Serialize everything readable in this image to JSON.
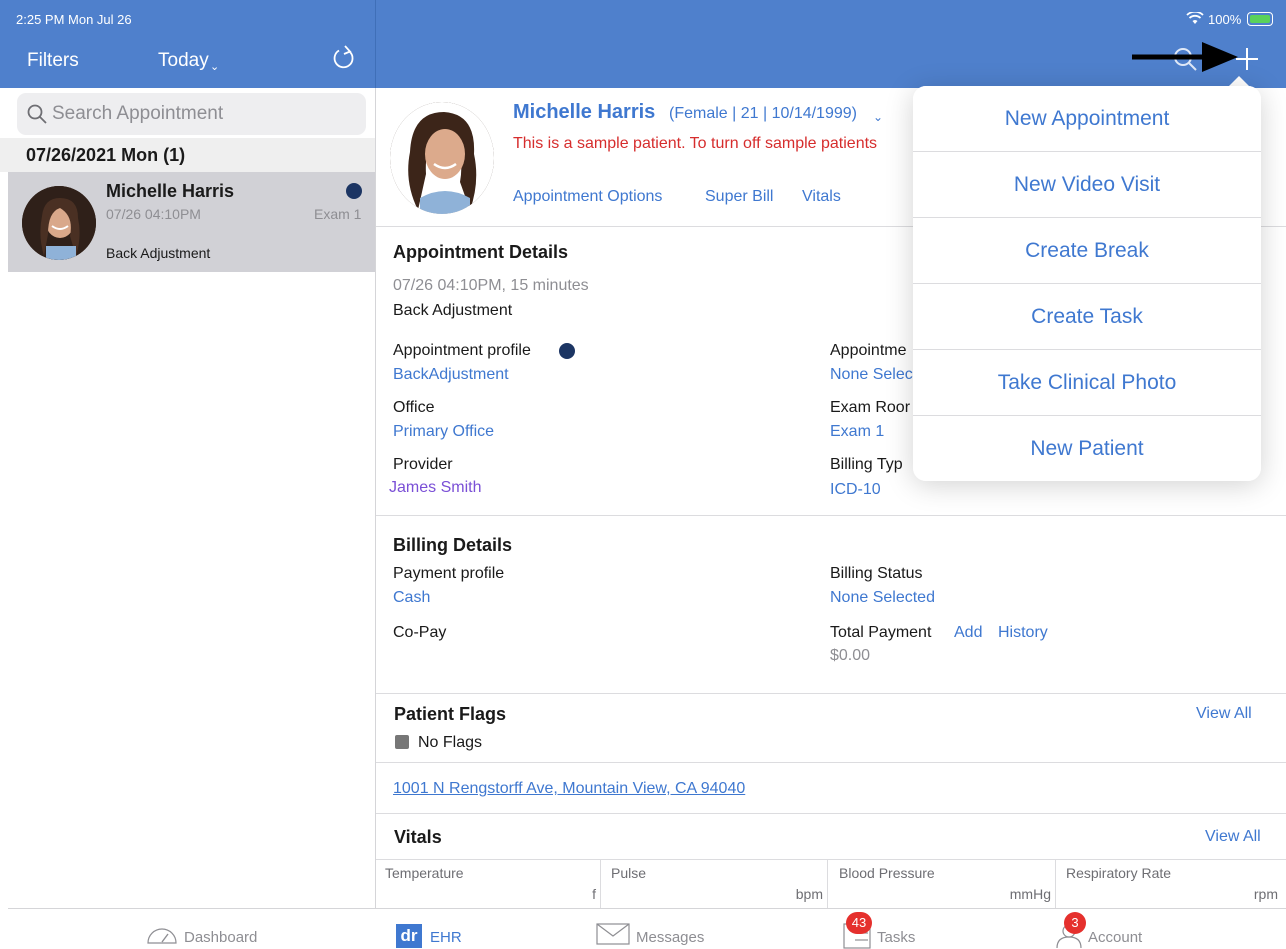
{
  "status_bar": {
    "time": "2:25 PM  Mon Jul 26",
    "battery": "100%"
  },
  "header": {
    "filters_label": "Filters",
    "today_label": "Today"
  },
  "sidebar": {
    "search_placeholder": "Search Appointment",
    "date_group": "07/26/2021 Mon (1)",
    "appointment": {
      "name": "Michelle Harris",
      "time": "07/26 04:10PM",
      "room": "Exam 1",
      "reason": "Back Adjustment"
    }
  },
  "patient": {
    "name": "Michelle Harris",
    "meta": "(Female | 21 | 10/14/1999)",
    "sample_notice": "This is a sample patient. To turn off sample patients",
    "links": {
      "appointment_options": "Appointment Options",
      "super_bill": "Super Bill",
      "vitals": "Vitals"
    }
  },
  "appointment_details": {
    "title": "Appointment Details",
    "datetime": "07/26 04:10PM, 15 minutes",
    "reason": "Back Adjustment",
    "profile_label": "Appointment profile",
    "profile_value": "BackAdjustment",
    "office_label": "Office",
    "office_value": "Primary Office",
    "provider_label": "Provider",
    "provider_value": "James Smith",
    "appt_status_label": "Appointme",
    "appt_status_value": "None Selec",
    "exam_room_label": "Exam Roor",
    "exam_room_value": "Exam 1",
    "billing_type_label": "Billing Typ",
    "billing_type_value": "ICD-10"
  },
  "billing_details": {
    "title": "Billing Details",
    "payment_profile_label": "Payment profile",
    "payment_profile_value": "Cash",
    "copay_label": "Co-Pay",
    "billing_status_label": "Billing Status",
    "billing_status_value": "None Selected",
    "total_payment_label": "Total Payment",
    "add_label": "Add",
    "history_label": "History",
    "total_payment_value": "$0.00"
  },
  "patient_flags": {
    "title": "Patient Flags",
    "view_all": "View All",
    "no_flags": "No Flags"
  },
  "address": "1001 N Rengstorff Ave, Mountain View, CA 94040",
  "vitals": {
    "title": "Vitals",
    "view_all": "View All",
    "cells": [
      {
        "label": "Temperature",
        "unit": "f"
      },
      {
        "label": "Pulse",
        "unit": "bpm"
      },
      {
        "label": "Blood Pressure",
        "unit": "mmHg"
      },
      {
        "label": "Respiratory Rate",
        "unit": "rpm"
      }
    ]
  },
  "tabbar": {
    "dashboard": "Dashboard",
    "ehr": "EHR",
    "ehr_logo": "dr",
    "messages": "Messages",
    "tasks": "Tasks",
    "tasks_badge": "43",
    "account": "Account",
    "account_badge": "3"
  },
  "popover_menu": {
    "items": [
      "New Appointment",
      "New Video Visit",
      "Create Break",
      "Create Task",
      "Take Clinical Photo",
      "New Patient"
    ]
  },
  "colors": {
    "header_blue": "#4f80cc",
    "link_blue": "#3f78d0",
    "sample_red": "#d62d2d",
    "status_dot": "#1c3563",
    "badge_red": "#e5302d"
  },
  "icons": [
    "refresh-icon",
    "search-icon",
    "plus-icon",
    "wifi-icon",
    "battery-icon",
    "dashboard-icon",
    "messages-icon",
    "tasks-icon",
    "account-icon"
  ]
}
